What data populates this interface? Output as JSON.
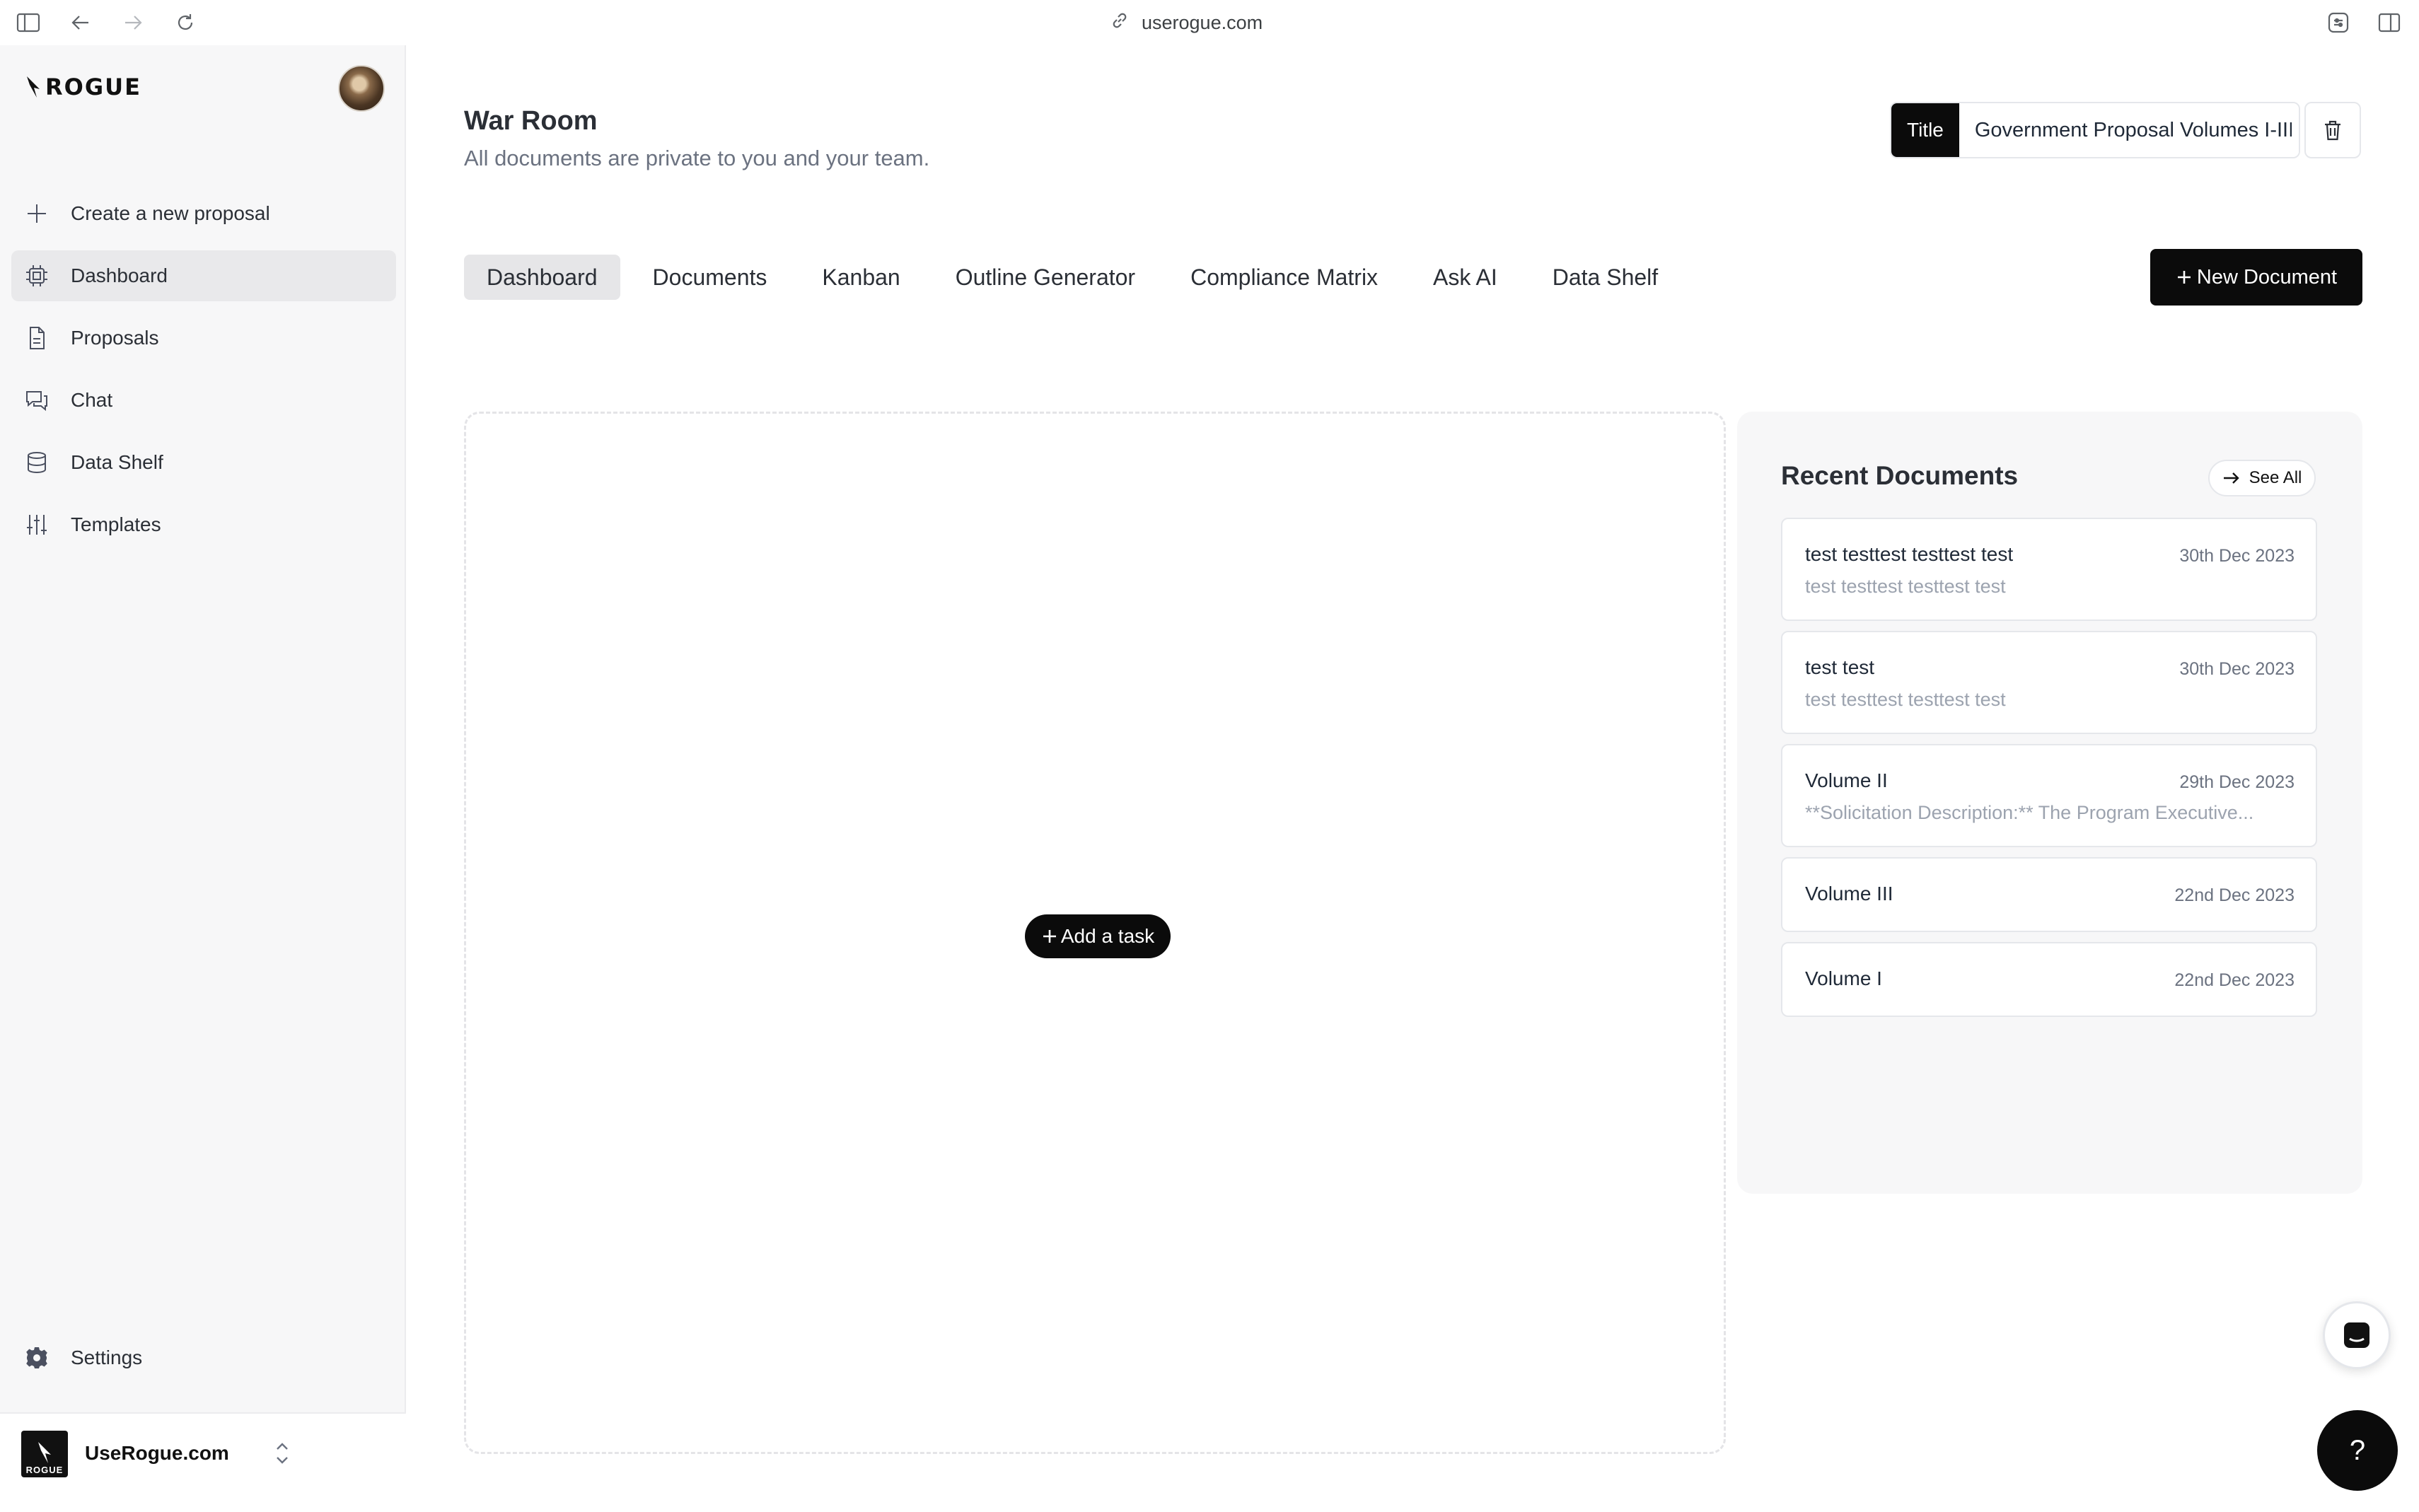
{
  "browser": {
    "url": "userogue.com"
  },
  "sidebar": {
    "logo_text": "ROGUE",
    "items": [
      {
        "label": "Create a new proposal",
        "icon": "plus-icon"
      },
      {
        "label": "Dashboard",
        "icon": "cpu-icon",
        "active": true
      },
      {
        "label": "Proposals",
        "icon": "file-icon"
      },
      {
        "label": "Chat",
        "icon": "chat-icon"
      },
      {
        "label": "Data Shelf",
        "icon": "database-icon"
      },
      {
        "label": "Templates",
        "icon": "sliders-icon"
      }
    ],
    "settings_label": "Settings",
    "workspace": {
      "name": "UseRogue.com",
      "logo_text": "ROGUE"
    }
  },
  "header": {
    "title": "War Room",
    "subtitle": "All documents are private to you and your team.",
    "title_tag": "Title",
    "title_value": "Government Proposal Volumes I-III"
  },
  "tabs": [
    {
      "label": "Dashboard",
      "active": true
    },
    {
      "label": "Documents"
    },
    {
      "label": "Kanban"
    },
    {
      "label": "Outline Generator"
    },
    {
      "label": "Compliance Matrix"
    },
    {
      "label": "Ask AI"
    },
    {
      "label": "Data Shelf"
    }
  ],
  "new_document_label": "New Document",
  "add_task_label": "Add a task",
  "recent": {
    "title": "Recent Documents",
    "see_all_label": "See All",
    "documents": [
      {
        "name": "test testtest testtest test",
        "date": "30th Dec 2023",
        "snippet": "test testtest testtest test"
      },
      {
        "name": "test test",
        "date": "30th Dec 2023",
        "snippet": "test testtest testtest test"
      },
      {
        "name": "Volume II",
        "date": "29th Dec 2023",
        "snippet": "**Solicitation Description:** The Program Executive..."
      },
      {
        "name": "Volume III",
        "date": "22nd Dec 2023",
        "snippet": ""
      },
      {
        "name": "Volume I",
        "date": "22nd Dec 2023",
        "snippet": ""
      }
    ]
  },
  "help_label": "?",
  "colors": {
    "accent": "#0b0b0b",
    "sidebar_bg": "#f7f7f8",
    "active_bg": "#e9e9eb"
  }
}
